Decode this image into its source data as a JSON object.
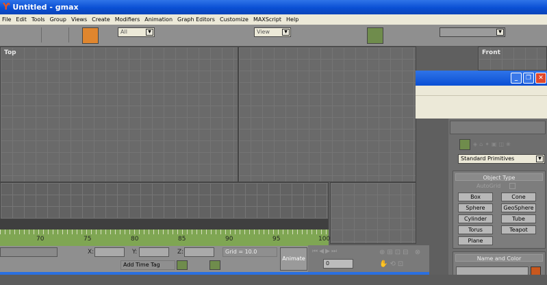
{
  "window": {
    "title": "Untitled - gmax"
  },
  "menu": [
    "File",
    "Edit",
    "Tools",
    "Group",
    "Views",
    "Create",
    "Modifiers",
    "Animation",
    "Graph Editors",
    "Customize",
    "MAXScript",
    "Help"
  ],
  "toolbar": {
    "filter_select": "All",
    "refcoord_select": "View",
    "named_sel": ""
  },
  "viewports": {
    "top": "Top",
    "front": "Front"
  },
  "panel": {
    "category": "Standard Primitives",
    "object_type": "Object Type",
    "autogrid": "AutoGrid",
    "buttons": [
      "Box",
      "Cone",
      "Sphere",
      "GeoSphere",
      "Cylinder",
      "Tube",
      "Torus",
      "Teapot",
      "Plane"
    ],
    "name_color": "Name and Color"
  },
  "timeline": {
    "ticks": [
      "70",
      "75",
      "80",
      "85",
      "90",
      "95",
      "100"
    ]
  },
  "status": {
    "x_label": "X:",
    "y_label": "Y:",
    "z_label": "Z:",
    "grid": "Grid = 10.0",
    "animate": "Animate",
    "add_time_tag": "Add Time Tag",
    "frame": "0"
  },
  "colors": {
    "object_color": "#e0862e",
    "swatch_green": "#6f8c4c",
    "timeline": "#7fa653",
    "name_color": "#c9581e"
  }
}
